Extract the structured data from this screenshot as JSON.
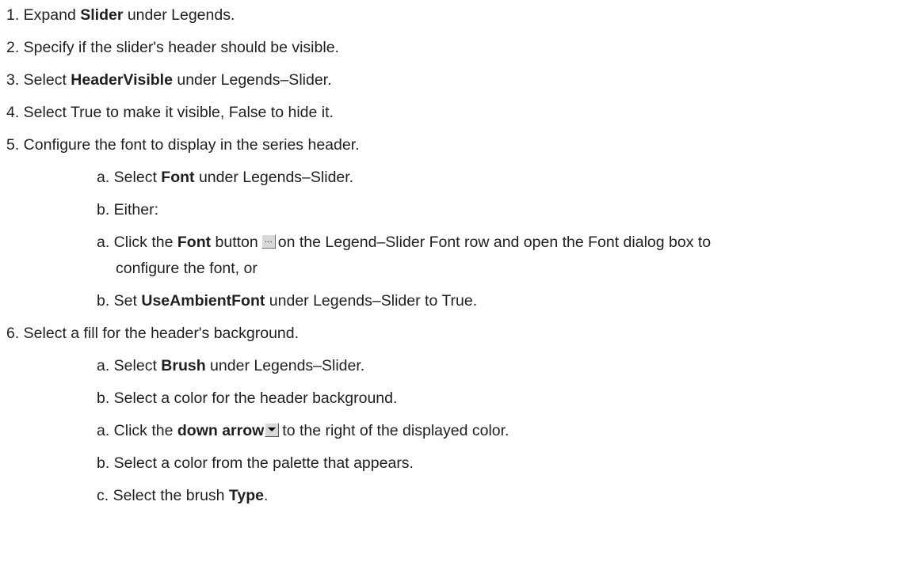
{
  "steps": {
    "s1": {
      "pre": "1. Expand ",
      "bold": "Slider",
      "post": " under Legends."
    },
    "s2": {
      "text": "2. Specify if the slider's header should be visible."
    },
    "s3": {
      "pre": "3. Select ",
      "bold": "HeaderVisible",
      "post": " under Legends–Slider."
    },
    "s4": {
      "text": "4. Select True to make it visible, False to hide it."
    },
    "s5": {
      "text": "5. Configure the font to display in the series header."
    },
    "s5a": {
      "pre": "a. Select ",
      "bold": "Font",
      "post": " under Legends–Slider."
    },
    "s5b": {
      "text": "b. Either:"
    },
    "s5c": {
      "pre": "a. Click the ",
      "bold": "Font",
      "mid": " button",
      "post": "on the Legend–Slider Font row and open the Font dialog box to",
      "cont": "configure the font, or",
      "icon": "ellipsis-button-icon"
    },
    "s5d": {
      "pre": "b. Set ",
      "bold": "UseAmbientFont",
      "post": " under Legends–Slider to True."
    },
    "s6": {
      "text": "6. Select a fill for the header's background."
    },
    "s6a": {
      "pre": "a. Select ",
      "bold": "Brush",
      "post": " under Legends–Slider."
    },
    "s6b": {
      "text": "b. Select a color for the header background."
    },
    "s6c": {
      "pre": "a. Click the ",
      "bold": "down arrow",
      "post": "to the right of the displayed color.",
      "icon": "dropdown-arrow-icon"
    },
    "s6d": {
      "text": "b. Select a color from the palette that appears."
    },
    "s6e": {
      "pre": "c. Select the brush ",
      "bold": "Type",
      "post": "."
    }
  }
}
